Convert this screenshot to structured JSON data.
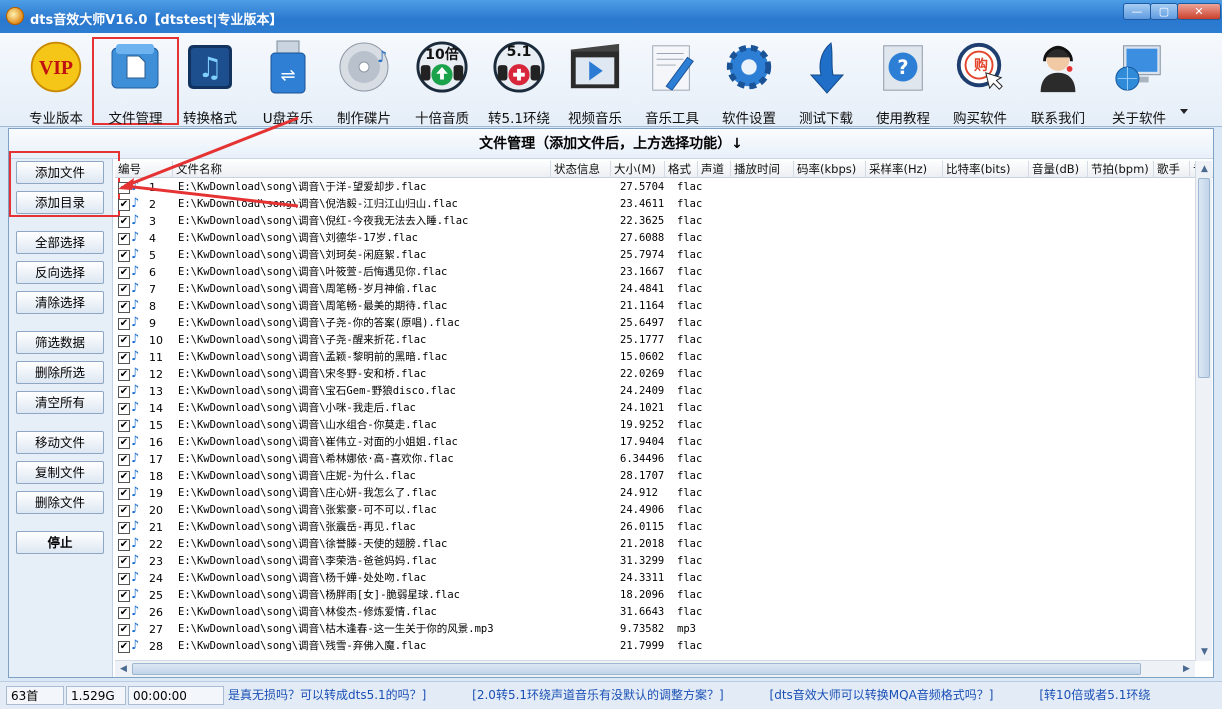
{
  "window": {
    "title": "dts音效大师V16.0【dtstest|专业版本】",
    "minimize_glyph": "—",
    "maximize_glyph": "▢",
    "close_glyph": "✕"
  },
  "toolbar": [
    {
      "label": "专业版本",
      "icon": "vip-icon"
    },
    {
      "label": "文件管理",
      "icon": "file-manage-icon"
    },
    {
      "label": "转换格式",
      "icon": "music-note-icon"
    },
    {
      "label": "U盘音乐",
      "icon": "usb-icon"
    },
    {
      "label": "制作碟片",
      "icon": "disc-icon"
    },
    {
      "label": "十倍音质",
      "icon": "tenx-icon",
      "badge": "10倍"
    },
    {
      "label": "转5.1环绕",
      "icon": "surround-icon",
      "badge": "5.1"
    },
    {
      "label": "视频音乐",
      "icon": "video-icon"
    },
    {
      "label": "音乐工具",
      "icon": "tools-icon"
    },
    {
      "label": "软件设置",
      "icon": "gear-icon"
    },
    {
      "label": "测试下载",
      "icon": "download-icon"
    },
    {
      "label": "使用教程",
      "icon": "help-icon"
    },
    {
      "label": "购买软件",
      "icon": "buy-icon",
      "badge": "购"
    },
    {
      "label": "联系我们",
      "icon": "headset-icon"
    },
    {
      "label": "关于软件",
      "icon": "computer-icon"
    }
  ],
  "main": {
    "banner": "文件管理（添加文件后，上方选择功能）↓"
  },
  "sidebar": {
    "buttons": [
      "添加文件",
      "添加目录",
      "全部选择",
      "反向选择",
      "清除选择",
      "筛选数据",
      "删除所选",
      "清空所有",
      "移动文件",
      "复制文件",
      "删除文件",
      "停止"
    ]
  },
  "table": {
    "columns": [
      "编号",
      "文件名称",
      "状态信息",
      "大小(M)",
      "格式",
      "声道",
      "播放时间",
      "码率(kbps)",
      "采样率(Hz)",
      "比特率(bits)",
      "音量(dB)",
      "节拍(bpm)",
      "歌手",
      "专"
    ],
    "check_glyph": "✔",
    "note_glyph": "♪",
    "rows": [
      {
        "n": "1",
        "path": "E:\\KwDownload\\song\\调音\\于洋-望爱却步.flac",
        "size": "27.5704",
        "fmt": "flac"
      },
      {
        "n": "2",
        "path": "E:\\KwDownload\\song\\调音\\倪浩毅-江归江山归山.flac",
        "size": "23.4611",
        "fmt": "flac"
      },
      {
        "n": "3",
        "path": "E:\\KwDownload\\song\\调音\\倪红-今夜我无法去入睡.flac",
        "size": "22.3625",
        "fmt": "flac"
      },
      {
        "n": "4",
        "path": "E:\\KwDownload\\song\\调音\\刘德华-17岁.flac",
        "size": "27.6088",
        "fmt": "flac"
      },
      {
        "n": "5",
        "path": "E:\\KwDownload\\song\\调音\\刘珂矣-闲庭絮.flac",
        "size": "25.7974",
        "fmt": "flac"
      },
      {
        "n": "6",
        "path": "E:\\KwDownload\\song\\调音\\叶筱萱-后悔遇见你.flac",
        "size": "23.1667",
        "fmt": "flac"
      },
      {
        "n": "7",
        "path": "E:\\KwDownload\\song\\调音\\周笔畅-岁月神偷.flac",
        "size": "24.4841",
        "fmt": "flac"
      },
      {
        "n": "8",
        "path": "E:\\KwDownload\\song\\调音\\周笔畅-最美的期待.flac",
        "size": "21.1164",
        "fmt": "flac"
      },
      {
        "n": "9",
        "path": "E:\\KwDownload\\song\\调音\\子尧-你的答案(原唱).flac",
        "size": "25.6497",
        "fmt": "flac"
      },
      {
        "n": "10",
        "path": "E:\\KwDownload\\song\\调音\\子尧-醒来折花.flac",
        "size": "25.1777",
        "fmt": "flac"
      },
      {
        "n": "11",
        "path": "E:\\KwDownload\\song\\调音\\孟颖-黎明前的黑暗.flac",
        "size": "15.0602",
        "fmt": "flac"
      },
      {
        "n": "12",
        "path": "E:\\KwDownload\\song\\调音\\宋冬野-安和桥.flac",
        "size": "22.0269",
        "fmt": "flac"
      },
      {
        "n": "13",
        "path": "E:\\KwDownload\\song\\调音\\宝石Gem-野狼disco.flac",
        "size": "24.2409",
        "fmt": "flac"
      },
      {
        "n": "14",
        "path": "E:\\KwDownload\\song\\调音\\小咪-我走后.flac",
        "size": "24.1021",
        "fmt": "flac"
      },
      {
        "n": "15",
        "path": "E:\\KwDownload\\song\\调音\\山水组合-你莫走.flac",
        "size": "19.9252",
        "fmt": "flac"
      },
      {
        "n": "16",
        "path": "E:\\KwDownload\\song\\调音\\崔伟立-对面的小姐姐.flac",
        "size": "17.9404",
        "fmt": "flac"
      },
      {
        "n": "17",
        "path": "E:\\KwDownload\\song\\调音\\希林娜依·高-喜欢你.flac",
        "size": "6.34496",
        "fmt": "flac"
      },
      {
        "n": "18",
        "path": "E:\\KwDownload\\song\\调音\\庄妮-为什么.flac",
        "size": "28.1707",
        "fmt": "flac"
      },
      {
        "n": "19",
        "path": "E:\\KwDownload\\song\\调音\\庄心妍-我怎么了.flac",
        "size": "24.912",
        "fmt": "flac"
      },
      {
        "n": "20",
        "path": "E:\\KwDownload\\song\\调音\\张紫豪-可不可以.flac",
        "size": "24.4906",
        "fmt": "flac"
      },
      {
        "n": "21",
        "path": "E:\\KwDownload\\song\\调音\\张震岳-再见.flac",
        "size": "26.0115",
        "fmt": "flac"
      },
      {
        "n": "22",
        "path": "E:\\KwDownload\\song\\调音\\徐誉滕-天使的翅膀.flac",
        "size": "21.2018",
        "fmt": "flac"
      },
      {
        "n": "23",
        "path": "E:\\KwDownload\\song\\调音\\李荣浩-爸爸妈妈.flac",
        "size": "31.3299",
        "fmt": "flac"
      },
      {
        "n": "24",
        "path": "E:\\KwDownload\\song\\调音\\杨千嬅-处处吻.flac",
        "size": "24.3311",
        "fmt": "flac"
      },
      {
        "n": "25",
        "path": "E:\\KwDownload\\song\\调音\\杨胖雨[女]-脆弱星球.flac",
        "size": "18.2096",
        "fmt": "flac"
      },
      {
        "n": "26",
        "path": "E:\\KwDownload\\song\\调音\\林俊杰-修炼爱情.flac",
        "size": "31.6643",
        "fmt": "flac"
      },
      {
        "n": "27",
        "path": "E:\\KwDownload\\song\\调音\\枯木逢春-这一生关于你的风景.mp3",
        "size": "9.73582",
        "fmt": "mp3"
      },
      {
        "n": "28",
        "path": "E:\\KwDownload\\song\\调音\\残雪-弃佛入魔.flac",
        "size": "21.7999",
        "fmt": "flac"
      }
    ]
  },
  "scroll": {
    "up": "▲",
    "down": "▼",
    "left": "◀",
    "right": "▶"
  },
  "status": {
    "count": "63首",
    "total_size": "1.529G",
    "time": "00:00:00",
    "tips": [
      "是真无损吗？可以转成dts5.1的吗？]",
      "[2.0转5.1环绕声道音乐有没默认的调整方案？]",
      "[dts音效大师可以转换MQA音频格式吗？]",
      "[转10倍或者5.1环绕"
    ]
  },
  "colors": {
    "accent_red": "#e53232",
    "link_blue": "#1a4fb5",
    "title_blue": "#2a78cf"
  }
}
